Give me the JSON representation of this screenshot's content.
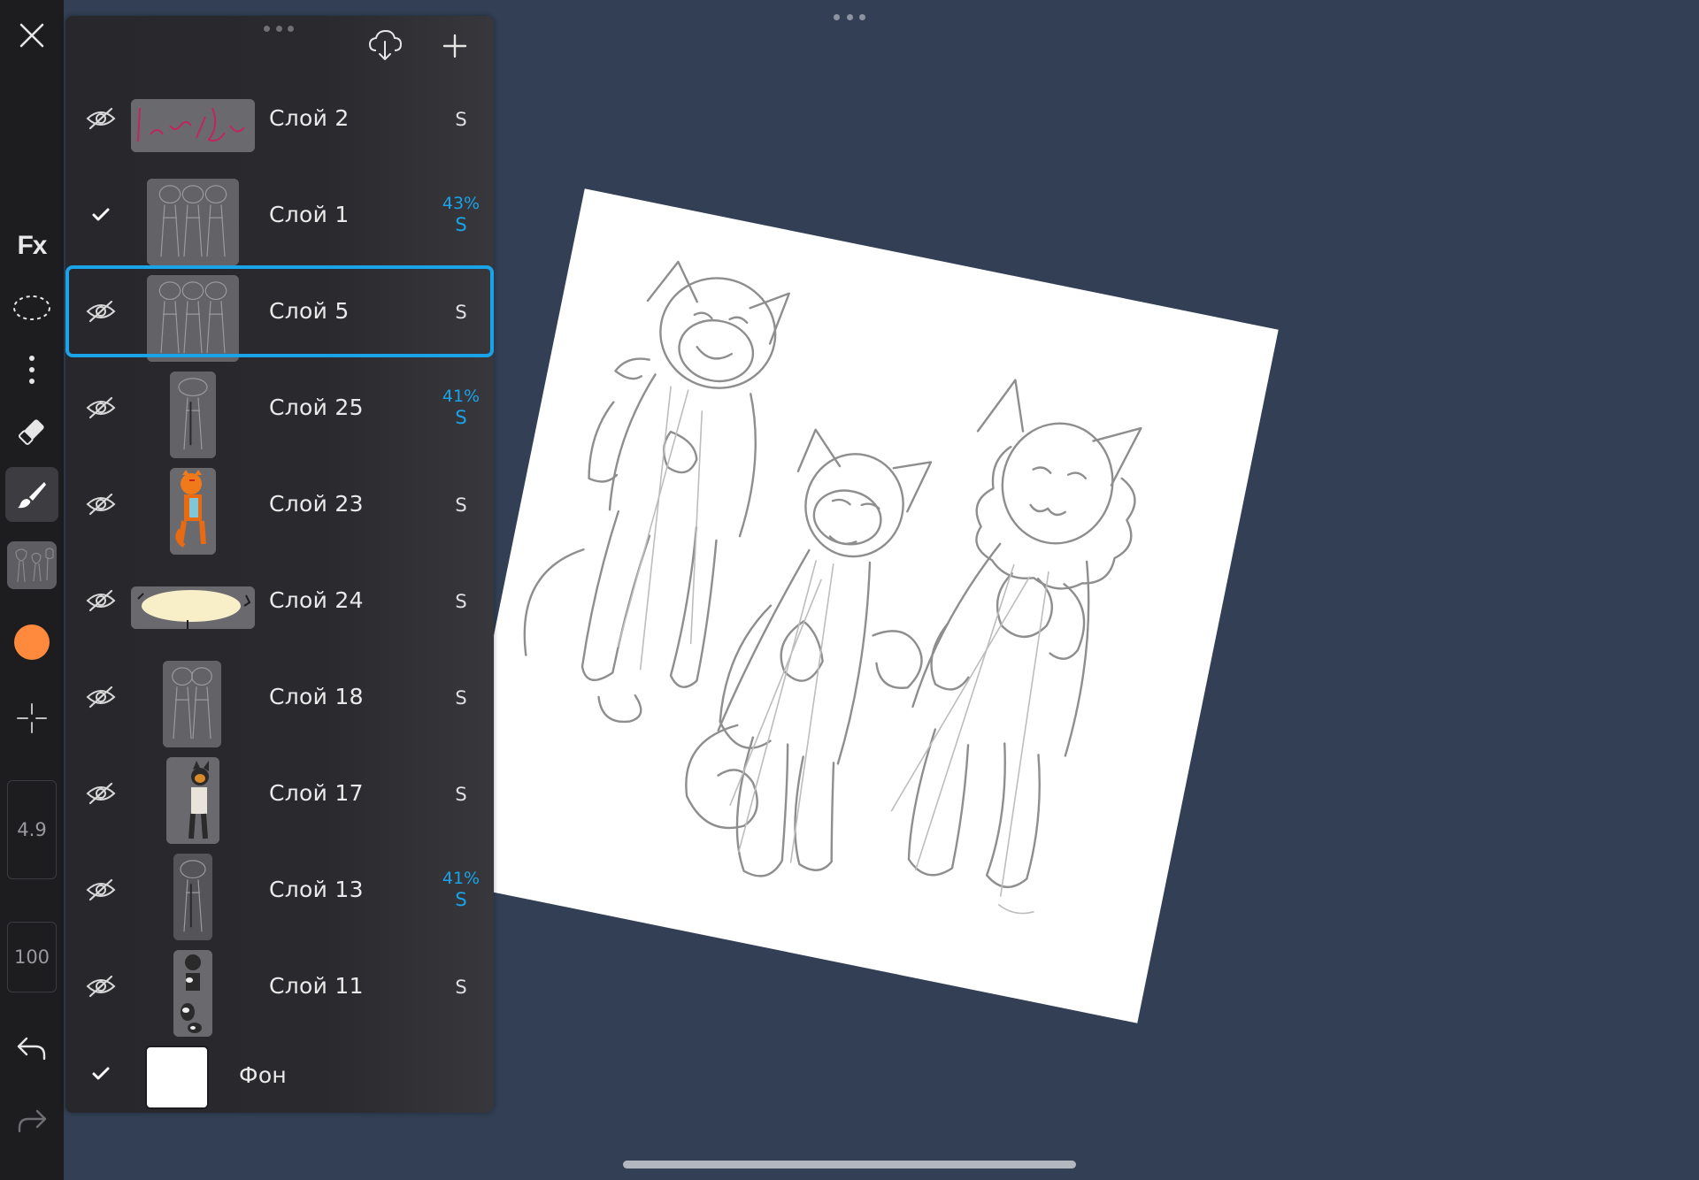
{
  "canvas": {
    "paper_color": "#ffffff",
    "background_color": "#323f54"
  },
  "toolbar": {
    "fx_label": "Fx",
    "brush_size": "4.9",
    "brush_opacity": "100",
    "current_color": "#ff8a3d",
    "icons": [
      "close-icon",
      "fx-icon",
      "lasso-select-icon",
      "more-vertical-icon",
      "eraser-icon",
      "brush-icon",
      "reference-thumbnail",
      "color-swatch",
      "transform-icon",
      "undo-icon",
      "redo-icon"
    ]
  },
  "layers_panel": {
    "header_icons": [
      "cloud-download-icon",
      "add-layer-icon"
    ],
    "layers": [
      {
        "name": "Слой 2",
        "visible": false,
        "opacity": "",
        "blend": "S",
        "selected": false
      },
      {
        "name": "Слой 1",
        "visible": true,
        "opacity": "43%",
        "blend": "S",
        "selected": false
      },
      {
        "name": "Слой 5",
        "visible": false,
        "opacity": "",
        "blend": "S",
        "selected": true
      },
      {
        "name": "Слой 25",
        "visible": false,
        "opacity": "41%",
        "blend": "S",
        "selected": false
      },
      {
        "name": "Слой 23",
        "visible": false,
        "opacity": "",
        "blend": "S",
        "selected": false
      },
      {
        "name": "Слой 24",
        "visible": false,
        "opacity": "",
        "blend": "S",
        "selected": false
      },
      {
        "name": "Слой 18",
        "visible": false,
        "opacity": "",
        "blend": "S",
        "selected": false
      },
      {
        "name": "Слой 17",
        "visible": false,
        "opacity": "",
        "blend": "S",
        "selected": false
      },
      {
        "name": "Слой 13",
        "visible": false,
        "opacity": "41%",
        "blend": "S",
        "selected": false
      },
      {
        "name": "Слой 11",
        "visible": false,
        "opacity": "",
        "blend": "S",
        "selected": false
      }
    ],
    "background_layer": {
      "name": "Фон",
      "visible": true
    }
  }
}
